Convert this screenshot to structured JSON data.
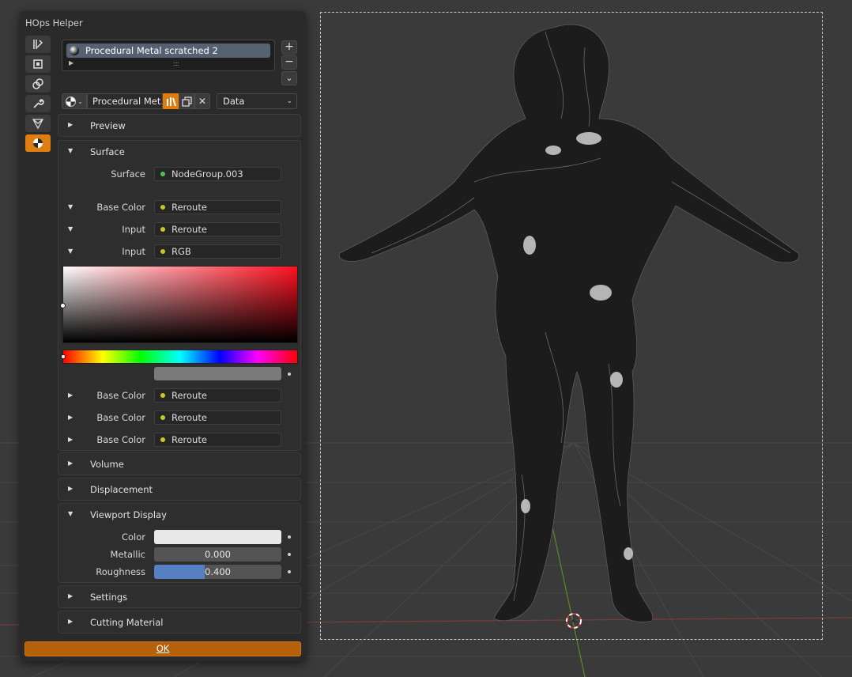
{
  "window": {
    "title": "HOps Helper"
  },
  "tabs": [
    {
      "id": "tool",
      "icon": "tool-icon",
      "active": false
    },
    {
      "id": "object",
      "icon": "object-icon",
      "active": false
    },
    {
      "id": "constraints",
      "icon": "constraints-icon",
      "active": false
    },
    {
      "id": "modifiers",
      "icon": "wrench-icon",
      "active": false
    },
    {
      "id": "data",
      "icon": "mesh-data-icon",
      "active": false
    },
    {
      "id": "material",
      "icon": "material-icon",
      "active": true
    }
  ],
  "slots": {
    "items": [
      {
        "label": "Procedural Metal scratched 2",
        "icon": "material-ball-icon"
      }
    ],
    "add": "+",
    "remove": "−",
    "menu": "⌄"
  },
  "material": {
    "name": "Procedural Met...",
    "link": "Data"
  },
  "sections": {
    "preview": "Preview",
    "surface": "Surface",
    "volume": "Volume",
    "displacement": "Displacement",
    "viewport_display": "Viewport Display",
    "settings": "Settings",
    "cutting_material": "Cutting Material"
  },
  "surface": {
    "surface_label": "Surface",
    "surface_value": "NodeGroup.003",
    "rows": [
      {
        "label": "Base Color",
        "value": "Reroute",
        "expanded": true
      },
      {
        "label": "Input",
        "value": "Reroute",
        "expanded": true
      },
      {
        "label": "Input",
        "value": "RGB",
        "expanded": true
      }
    ],
    "more_rows": [
      {
        "label": "Base Color",
        "value": "Reroute"
      },
      {
        "label": "Base Color",
        "value": "Reroute"
      },
      {
        "label": "Base Color",
        "value": "Reroute"
      }
    ],
    "socket_colors": {
      "shader": "#4fc24f",
      "color": "#c7c729"
    }
  },
  "viewport_display": {
    "color_label": "Color",
    "color_value": "#e8e8e8",
    "metallic_label": "Metallic",
    "metallic_value": "0.000",
    "roughness_label": "Roughness",
    "roughness_value": "0.400",
    "roughness_fraction": 0.4
  },
  "ok_label": "OK",
  "colors": {
    "accent": "#e07d10",
    "selected_slot": "#556070",
    "roughness_fill": "#5680c2"
  }
}
